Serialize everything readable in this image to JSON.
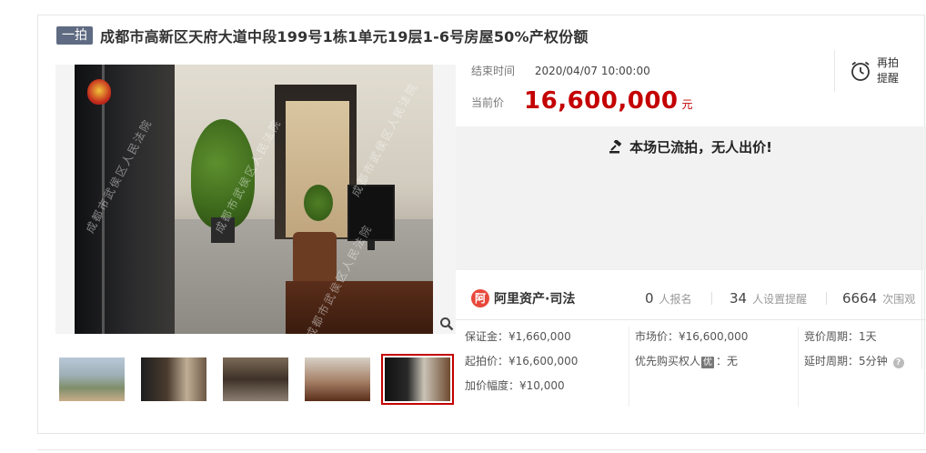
{
  "listing": {
    "badge": "一拍",
    "title": "成都市高新区天府大道中段199号1栋1单元19层1-6号房屋50%产权份额"
  },
  "gallery": {
    "watermark": "成都市武侯区人民法院",
    "zoom_icon": "search-icon",
    "thumbnails": [
      {
        "name": "exterior",
        "active": false
      },
      {
        "name": "office-interior",
        "active": false
      },
      {
        "name": "corridor",
        "active": false
      },
      {
        "name": "desk-area",
        "active": false
      },
      {
        "name": "entrance",
        "active": true
      }
    ]
  },
  "auction": {
    "end_time_label": "结束时间",
    "end_time": "2020/04/07 10:00:00",
    "current_price_label": "当前价",
    "current_price": "16,600,000",
    "currency_unit": "元",
    "remind_label_line1": "再拍",
    "remind_label_line2": "提醒",
    "status_notice": "本场已流拍，无人出价!"
  },
  "stats": {
    "brand": "阿里资产·司法",
    "brand_logo": "阿",
    "registered_count": "0",
    "registered_label": "人报名",
    "reminder_count": "34",
    "reminder_label": "人设置提醒",
    "viewer_count": "6664",
    "viewer_label": "次围观"
  },
  "details": {
    "deposit": "保证金：¥1,660,000",
    "starting_price": "起拍价：¥16,600,000",
    "increment": "加价幅度：¥10,000",
    "market_price": "市场价：¥16,600,000",
    "priority_label": "优先购买权人",
    "priority_badge": "优",
    "priority_value": "：无",
    "bid_period": "竞价周期：1天",
    "extension_period": "延时周期：5分钟",
    "help_icon": "?"
  },
  "colors": {
    "accent_red": "#c40000",
    "badge_bg": "#5f6b82",
    "notice_bg": "#f2f2f2"
  }
}
